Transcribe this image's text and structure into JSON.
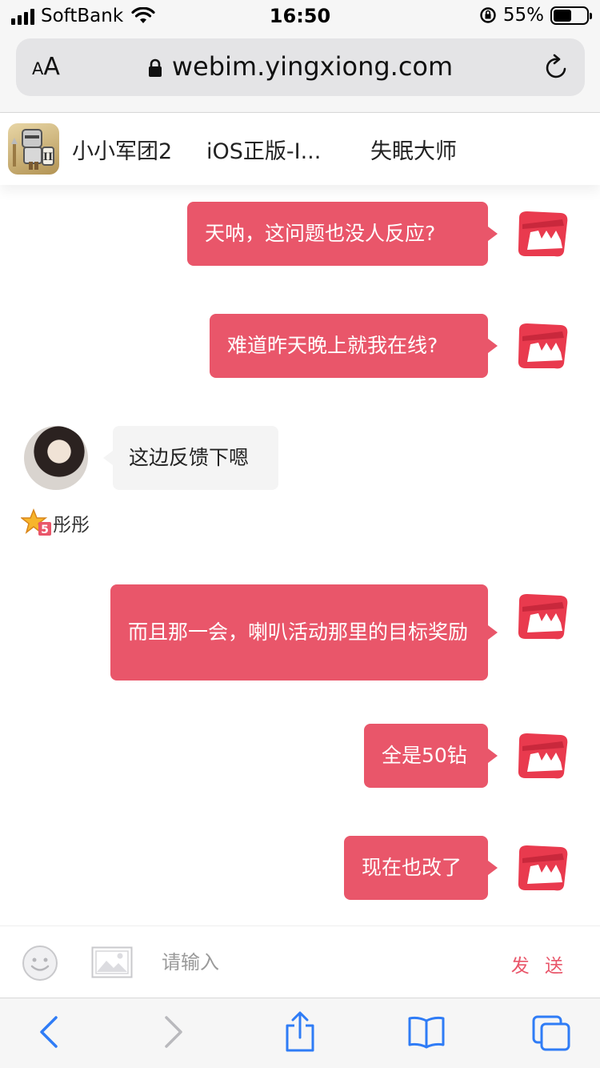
{
  "status_bar": {
    "carrier": "SoftBank",
    "time": "16:50",
    "battery": "55%",
    "battery_level": 0.55
  },
  "browser": {
    "aa_label_small": "A",
    "aa_label_large": "A",
    "url": "webim.yingxiong.com"
  },
  "header": {
    "tabs": [
      {
        "label": "小小军团2"
      },
      {
        "label": "iOS正版-I..."
      },
      {
        "label": "失眠大师"
      }
    ]
  },
  "chat": {
    "messages": [
      {
        "from": "me",
        "text": "天呐，这问题也没人反应?"
      },
      {
        "from": "me",
        "text": "难道昨天晚上就我在线?"
      },
      {
        "from": "other",
        "text": "这边反馈下嗯",
        "username": "彤彤"
      },
      {
        "from": "me",
        "text": "而且那一会，喇叭活动那里的目标奖励"
      },
      {
        "from": "me",
        "text": "全是50钻"
      },
      {
        "from": "me",
        "text": "现在也改了"
      }
    ],
    "accent_color": "#e9566a"
  },
  "input_bar": {
    "placeholder": "请输入",
    "send_label": "发 送"
  },
  "icons": {
    "emoji": "emoji-icon",
    "image": "image-icon",
    "back": "back-icon",
    "forward": "forward-icon",
    "share": "share-icon",
    "bookmarks": "bookmarks-icon",
    "tabs": "tabs-icon"
  }
}
